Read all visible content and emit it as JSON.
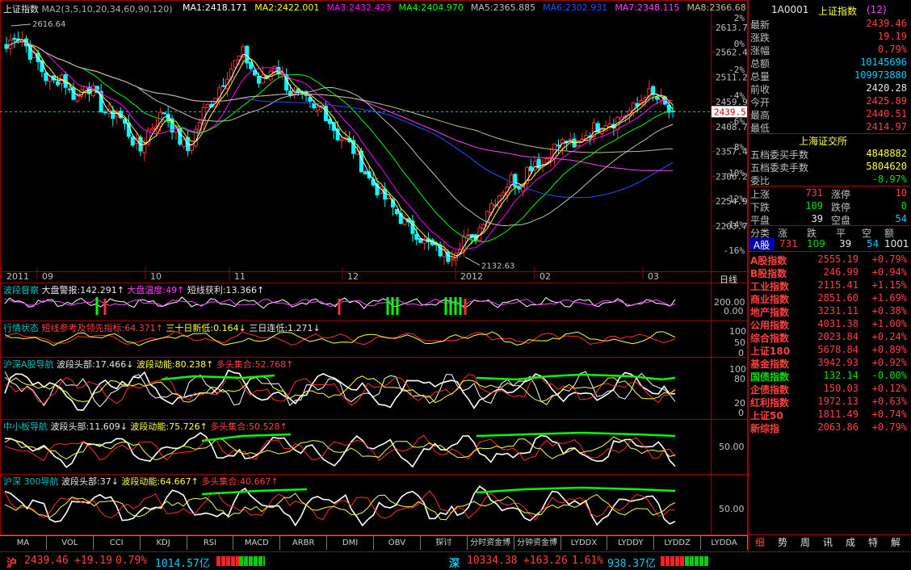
{
  "main_panel": {
    "name": "上证指数",
    "ma_params": "MA2(3,5,10,20,34,60,90,120)",
    "ma_values": [
      {
        "label": "MA1:2418.171",
        "color": "#ffffff"
      },
      {
        "label": "MA2:2422.001",
        "color": "#ffff00"
      },
      {
        "label": "MA3:2432.423",
        "color": "#ff00ff"
      },
      {
        "label": "MA4:2404.970",
        "color": "#00ff00"
      },
      {
        "label": "MA5:2365.885",
        "color": "#c0c0c0"
      },
      {
        "label": "MA6:2302.931",
        "color": "#2050ff"
      },
      {
        "label": "MA7:2348.115",
        "color": "#ff40ff"
      },
      {
        "label": "MA8:2366.68",
        "color": "#c0c080"
      }
    ],
    "max_label": "2616.64",
    "min_label": "2132.63",
    "last_close_label": "2439.5",
    "y_ticks": [
      "2613.7",
      "2562.4",
      "2511.2",
      "2459.9",
      "2408.7",
      "2357.4",
      "2306.2",
      "2254.9",
      "2203.7"
    ],
    "pct_ticks": [
      "2%",
      "0%",
      "-2%",
      "-4%",
      "-6%",
      "-8%",
      "-10%",
      "-12%",
      "-14%",
      "-16%"
    ],
    "x_labels": [
      "2011",
      "09",
      "10",
      "11",
      "12",
      "2012",
      "02",
      "03"
    ],
    "period": "日线"
  },
  "chart_data": [
    {
      "type": "candlestick",
      "title": "上证指数",
      "ylim": [
        2120,
        2640
      ],
      "x": [
        "2011-08",
        "2011-09",
        "2011-10",
        "2011-11",
        "2011-12",
        "2012-01",
        "2012-02",
        "2012-03"
      ],
      "close_path": [
        2570,
        2600,
        2590,
        2560,
        2540,
        2510,
        2500,
        2515,
        2480,
        2470,
        2500,
        2480,
        2450,
        2430,
        2440,
        2410,
        2380,
        2360,
        2400,
        2420,
        2440,
        2410,
        2380,
        2360,
        2400,
        2440,
        2460,
        2490,
        2520,
        2540,
        2560,
        2530,
        2500,
        2510,
        2540,
        2510,
        2480,
        2470,
        2460,
        2440,
        2450,
        2420,
        2390,
        2380,
        2360,
        2330,
        2300,
        2280,
        2260,
        2240,
        2220,
        2200,
        2190,
        2170,
        2160,
        2150,
        2140,
        2160,
        2180,
        2170,
        2200,
        2240,
        2260,
        2280,
        2300,
        2290,
        2320,
        2340,
        2330,
        2360,
        2370,
        2380,
        2360,
        2390,
        2400,
        2410,
        2420,
        2420,
        2430,
        2440,
        2450,
        2480,
        2470,
        2460,
        2439.46
      ],
      "last_close": 2439.46,
      "high": 2616.64,
      "low": 2132.63
    },
    {
      "type": "line",
      "title": "波段督察",
      "series_labels": [
        "大盘警报:142.291↑",
        "大盘温度:49↑",
        "短线获利:13.366↑"
      ],
      "y_ticks": [
        "200.00",
        "0.00"
      ]
    },
    {
      "type": "line",
      "title": "行情状态",
      "series_labels": [
        "短线参考及领先指标:64.371↑",
        "三十日新低:0.164↓",
        "三日连低:1.271↓"
      ],
      "y_ticks": [
        "100",
        "50",
        "0"
      ]
    },
    {
      "type": "line",
      "title": "沪深A股导航",
      "series_labels": [
        "波段头部:17.466↓",
        "波段动能:80.238↑",
        "多头集合:52.768↑"
      ],
      "y_ticks": [
        "100",
        "80",
        "20",
        "0"
      ]
    },
    {
      "type": "line",
      "title": "中小板导航",
      "series_labels": [
        "波段头部:11.609↓",
        "波段动能:75.726↑",
        "多头集合:50.528↑"
      ],
      "y_ticks": [
        "50.00"
      ]
    },
    {
      "type": "line",
      "title": "沪深 300导航",
      "series_labels": [
        "波段头部:37↓",
        "波段动能:64.667↑",
        "多头集合:40.667↑"
      ],
      "y_ticks": [
        "50.00"
      ]
    }
  ],
  "quote": {
    "code": "1A0001",
    "name": "上证指数",
    "count": "(12)",
    "rows": [
      {
        "label": "最新",
        "value": "2439.46",
        "color": "red"
      },
      {
        "label": "涨跌",
        "value": "19.19",
        "color": "red"
      },
      {
        "label": "涨幅",
        "value": "0.79%",
        "color": "red"
      },
      {
        "label": "总额",
        "value": "10145696",
        "color": "cyan"
      },
      {
        "label": "总量",
        "value": "109973880",
        "color": "cyan"
      },
      {
        "label": "前收",
        "value": "2420.28",
        "color": "white"
      },
      {
        "label": "今开",
        "value": "2425.89",
        "color": "red"
      },
      {
        "label": "最高",
        "value": "2440.51",
        "color": "red"
      },
      {
        "label": "最低",
        "value": "2414.97",
        "color": "red"
      }
    ],
    "exchange": "上海证交所",
    "book": [
      {
        "label": "五档委买手数",
        "value": "4848882",
        "color": "yellow"
      },
      {
        "label": "五档委卖手数",
        "value": "5804620",
        "color": "yellow"
      },
      {
        "label": "委比",
        "value": "-8.97%",
        "color": "green"
      }
    ],
    "breadth": [
      {
        "l1": "上涨",
        "v1": "731",
        "c1": "red",
        "l2": "涨停",
        "v2": "10",
        "c2": "red"
      },
      {
        "l1": "下跌",
        "v1": "109",
        "c1": "green",
        "l2": "跌停",
        "v2": "0",
        "c2": "green"
      },
      {
        "l1": "平盘",
        "v1": "39",
        "c1": "white",
        "l2": "空盘",
        "v2": "54",
        "c2": "cyan"
      }
    ],
    "class_headers": [
      "分类",
      "涨",
      "跌",
      "平",
      "空",
      "额"
    ],
    "class_row": {
      "name": "A股",
      "up": "731",
      "down": "109",
      "flat": "39",
      "empty": "54",
      "amount": "1001"
    },
    "indices": [
      {
        "name": "A股指数",
        "value": "2555.19",
        "pct": "+0.79%",
        "color": "red"
      },
      {
        "name": "B股指数",
        "value": "246.99",
        "pct": "+0.94%",
        "color": "red"
      },
      {
        "name": "工业指数",
        "value": "2115.41",
        "pct": "+1.15%",
        "color": "red"
      },
      {
        "name": "商业指数",
        "value": "2851.60",
        "pct": "+1.69%",
        "color": "red"
      },
      {
        "name": "地产指数",
        "value": "3231.11",
        "pct": "+0.38%",
        "color": "red"
      },
      {
        "name": "公用指数",
        "value": "4031.38",
        "pct": "+1.00%",
        "color": "red"
      },
      {
        "name": "综合指数",
        "value": "2023.84",
        "pct": "+0.24%",
        "color": "red"
      },
      {
        "name": "上证180",
        "value": "5678.84",
        "pct": "+0.89%",
        "color": "red"
      },
      {
        "name": "基金指数",
        "value": "3942.93",
        "pct": "+0.92%",
        "color": "red"
      },
      {
        "name": "国债指数",
        "value": "132.14",
        "pct": "-0.00%",
        "color": "green"
      },
      {
        "name": "企债指数",
        "value": "150.03",
        "pct": "+0.12%",
        "color": "red"
      },
      {
        "name": "红利指数",
        "value": "1972.13",
        "pct": "+0.63%",
        "color": "red"
      },
      {
        "name": "上证50",
        "value": "1811.49",
        "pct": "+0.74%",
        "color": "red"
      },
      {
        "name": "新综指",
        "value": "2063.86",
        "pct": "+0.79%",
        "color": "red"
      }
    ],
    "bottom_tabs": [
      "细",
      "势",
      "周",
      "讯",
      "成",
      "特",
      "解"
    ]
  },
  "indicator_tabs": [
    "MA",
    "VOL",
    "CCI",
    "KDJ",
    "RSI",
    "MACD",
    "ARBR",
    "DMI",
    "OBV",
    "探讨",
    "分时资金博",
    "分钟资金博",
    "LYDDX",
    "LYDDY",
    "LYDDZ",
    "LYDDA"
  ],
  "status": {
    "sh_label": "沪",
    "sh_value": "2439.46",
    "sh_change": "+19.19",
    "sh_pct": "0.79%",
    "sh_amount": "1014.57亿",
    "sz_label": "深",
    "sz_value": "10334.38",
    "sz_change": "+163.26",
    "sz_pct": "1.61%",
    "sz_amount": "938.37亿"
  }
}
